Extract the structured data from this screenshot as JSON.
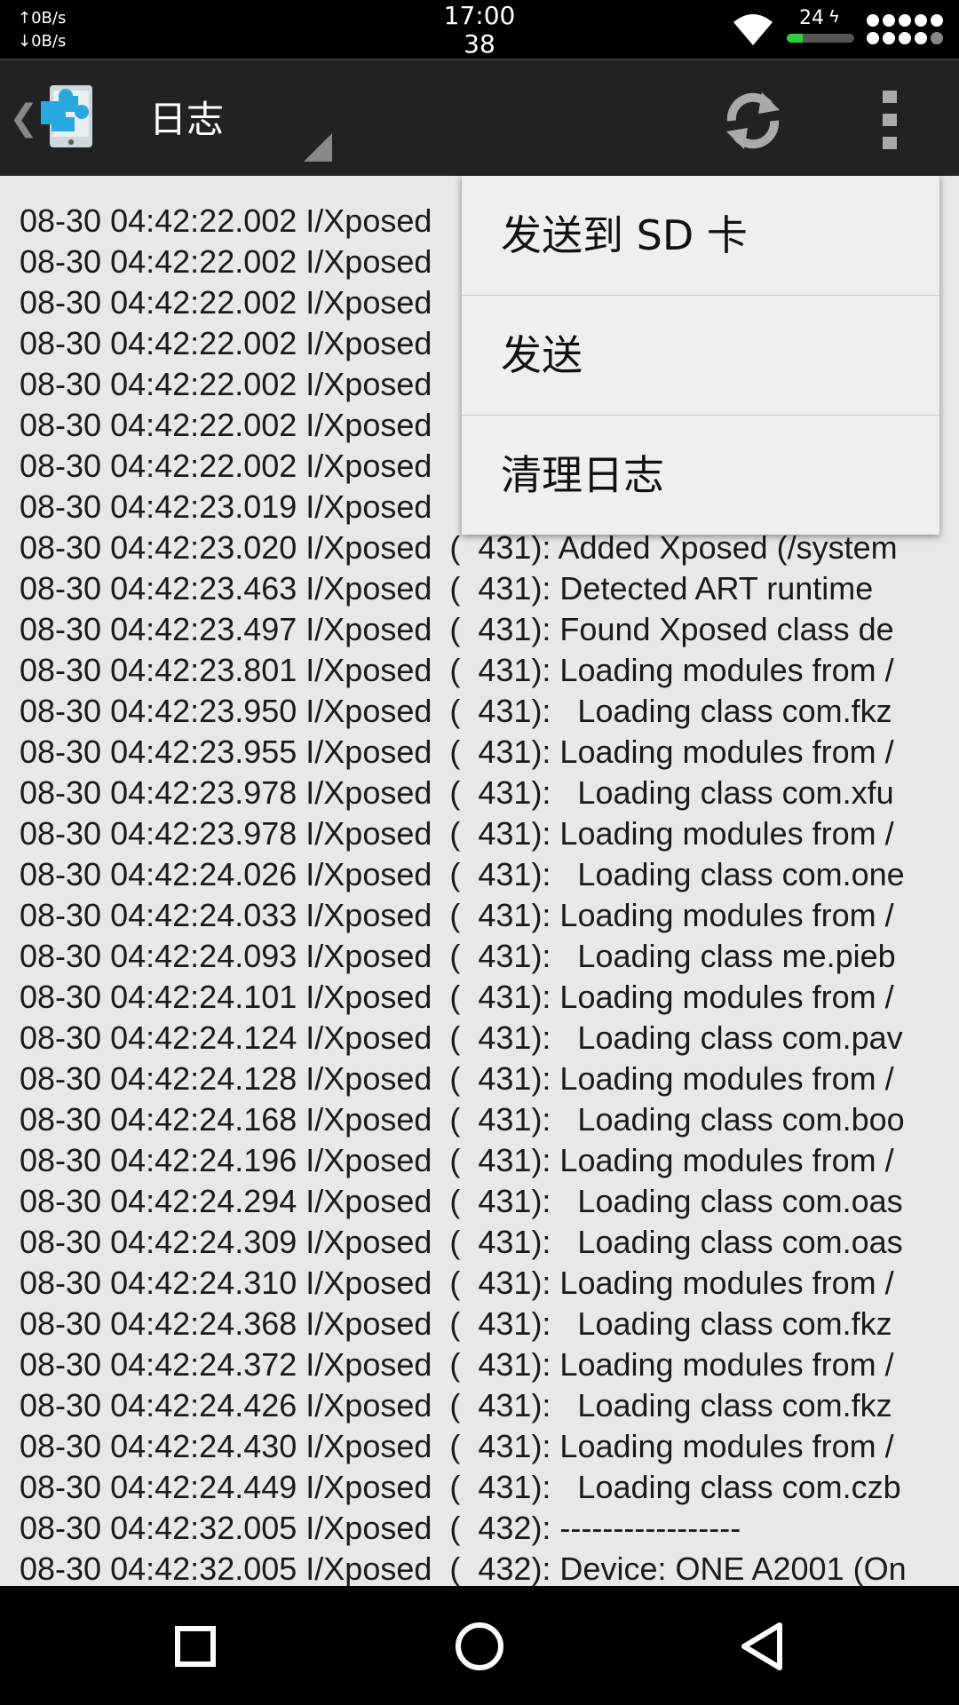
{
  "status_bar": {
    "upload_speed": "↑0B/s",
    "download_speed": "↓0B/s",
    "time": "17:00",
    "seconds": "38",
    "battery_level": "24",
    "battery_fraction": 0.24
  },
  "action_bar": {
    "title": "日志",
    "icons": {
      "up": "chevron-left-icon",
      "app": "xposed-puzzle-icon",
      "refresh": "refresh-icon",
      "overflow": "more-vert-icon"
    }
  },
  "menu": {
    "items": [
      {
        "label": "发送到 SD 卡"
      },
      {
        "label": "发送"
      },
      {
        "label": "清理日志"
      }
    ]
  },
  "log_lines": [
    "08-30 04:42:22.002 I/Xposed",
    "08-30 04:42:22.002 I/Xposed",
    "08-30 04:42:22.002 I/Xposed",
    "08-30 04:42:22.002 I/Xposed",
    "08-30 04:42:22.002 I/Xposed",
    "08-30 04:42:22.002 I/Xposed",
    "08-30 04:42:22.002 I/Xposed",
    "08-30 04:42:23.019 I/Xposed",
    "08-30 04:42:23.020 I/Xposed  (  431): Added Xposed (/system",
    "08-30 04:42:23.463 I/Xposed  (  431): Detected ART runtime",
    "08-30 04:42:23.497 I/Xposed  (  431): Found Xposed class de",
    "08-30 04:42:23.801 I/Xposed  (  431): Loading modules from /",
    "08-30 04:42:23.950 I/Xposed  (  431):   Loading class com.fkz",
    "08-30 04:42:23.955 I/Xposed  (  431): Loading modules from /",
    "08-30 04:42:23.978 I/Xposed  (  431):   Loading class com.xfu",
    "08-30 04:42:23.978 I/Xposed  (  431): Loading modules from /",
    "08-30 04:42:24.026 I/Xposed  (  431):   Loading class com.one",
    "08-30 04:42:24.033 I/Xposed  (  431): Loading modules from /",
    "08-30 04:42:24.093 I/Xposed  (  431):   Loading class me.pieb",
    "08-30 04:42:24.101 I/Xposed  (  431): Loading modules from /",
    "08-30 04:42:24.124 I/Xposed  (  431):   Loading class com.pav",
    "08-30 04:42:24.128 I/Xposed  (  431): Loading modules from /",
    "08-30 04:42:24.168 I/Xposed  (  431):   Loading class com.boo",
    "08-30 04:42:24.196 I/Xposed  (  431): Loading modules from /",
    "08-30 04:42:24.294 I/Xposed  (  431):   Loading class com.oas",
    "08-30 04:42:24.309 I/Xposed  (  431):   Loading class com.oas",
    "08-30 04:42:24.310 I/Xposed  (  431): Loading modules from /",
    "08-30 04:42:24.368 I/Xposed  (  431):   Loading class com.fkz",
    "08-30 04:42:24.372 I/Xposed  (  431): Loading modules from /",
    "08-30 04:42:24.426 I/Xposed  (  431):   Loading class com.fkz",
    "08-30 04:42:24.430 I/Xposed  (  431): Loading modules from /",
    "08-30 04:42:24.449 I/Xposed  (  431):   Loading class com.czb",
    "08-30 04:42:32.005 I/Xposed  (  432): -----------------",
    "08-30 04:42:32.005 I/Xposed  (  432): Device: ONE A2001 (On"
  ],
  "nav_bar": {
    "icons": {
      "recents": "recents-square-icon",
      "home": "home-circle-icon",
      "back": "back-triangle-icon"
    }
  },
  "colors": {
    "action_bar_bg": "#222222",
    "log_bg": "#e8e8e8",
    "menu_bg": "#efefef",
    "battery_green": "#2ecc40",
    "app_icon_blue": "#29a8e0"
  }
}
